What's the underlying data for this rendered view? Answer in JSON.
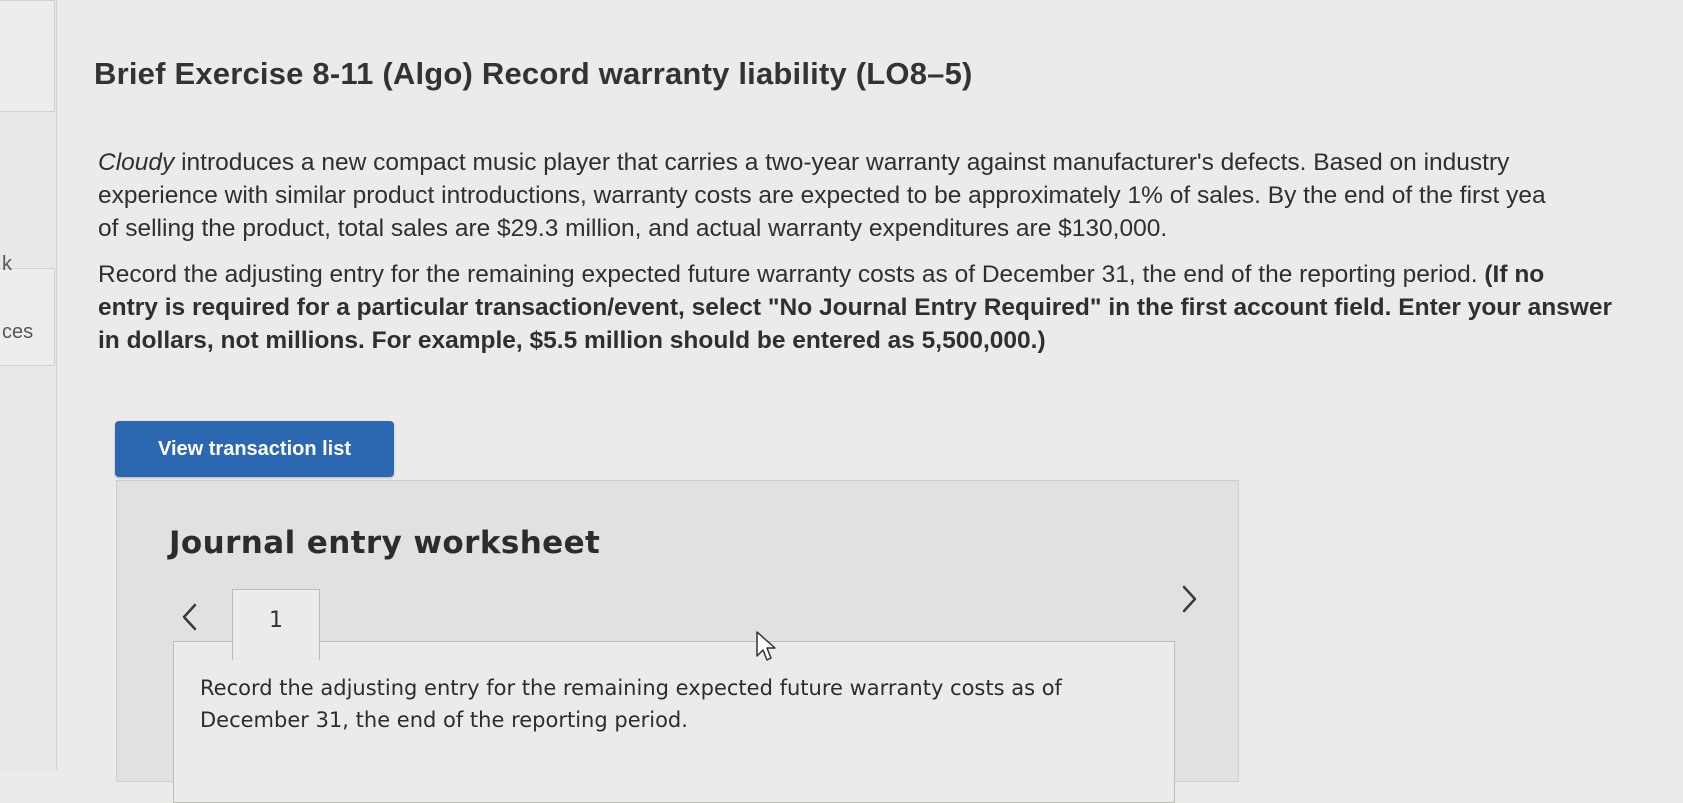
{
  "sidebar": {
    "fragment_top": "k",
    "fragment_mid": "ces"
  },
  "exercise": {
    "title": "Brief Exercise 8-11 (Algo) Record warranty liability (LO8–5)",
    "company": "Cloudy",
    "intro_line1": " introduces a new compact music player that carries a two-year warranty against manufacturer's defects. Based on industry",
    "intro_line2": "experience with similar product introductions, warranty costs are expected to be approximately 1% of sales. By the end of the first yea",
    "intro_line3": "of selling the product, total sales are $29.3 million, and actual warranty expenditures are $130,000.",
    "instruction_line1_plain": "Record the adjusting entry for the remaining expected future warranty costs as of December 31, the end of the reporting period. ",
    "instruction_line1_bold": "(If no",
    "instruction_line2_bold": "entry is required for a particular transaction/event, select \"No Journal Entry Required\" in the first account field. Enter your answer",
    "instruction_line3_bold": "in dollars, not millions. For example, $5.5 million should be entered as 5,500,000.)"
  },
  "buttons": {
    "view_transactions": "View transaction list"
  },
  "worksheet": {
    "title": "Journal entry worksheet",
    "tabs": [
      "1"
    ],
    "active_tab": "1",
    "instruction": "Record the adjusting entry for the remaining expected future warranty costs as of December 31, the end of the reporting period."
  },
  "colors": {
    "button_blue": "#2c68b2",
    "page_bg": "#ecebe9",
    "worksheet_bg": "#e2e1df"
  },
  "icons": {
    "prev": "chevron-left-icon",
    "next": "chevron-right-icon",
    "pointer": "mouse-cursor-icon"
  }
}
